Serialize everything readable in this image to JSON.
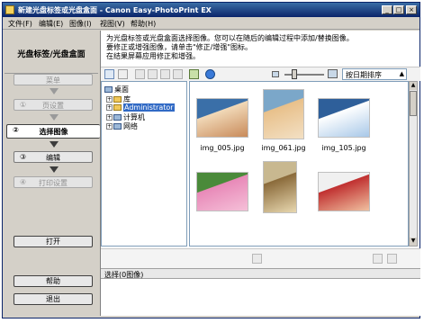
{
  "window": {
    "title": "新建光盘标签或光盘盒面 - Canon Easy-PhotoPrint EX"
  },
  "menu": [
    "文件(F)",
    "编辑(E)",
    "图像(I)",
    "视图(V)",
    "帮助(H)"
  ],
  "left_panel": {
    "heading": "光盘标签/光盘盒面",
    "steps": [
      {
        "num": "",
        "label": "菜单",
        "state": "disabled"
      },
      {
        "num": "①",
        "label": "页设置",
        "state": "disabled"
      },
      {
        "num": "②",
        "label": "选择图像",
        "state": "active"
      },
      {
        "num": "③",
        "label": "编辑",
        "state": "enabled"
      },
      {
        "num": "④",
        "label": "打印设置",
        "state": "disabled"
      }
    ],
    "open_label": "打开",
    "help_label": "帮助",
    "exit_label": "退出"
  },
  "instructions": "为光盘标签或光盘盒面选择图像。您可以在随后的编辑过程中添加/替换图像。\n要修正或增强图像，请单击\"修正/增强\"图标。\n在结果屏幕应用修正和增强。",
  "toolbar": {
    "sort_value": "按日期排序"
  },
  "tree": {
    "root": "桌面",
    "items": [
      "库",
      "Administrator",
      "计算机",
      "网络"
    ],
    "selected": "Administrator"
  },
  "images": [
    {
      "name": "img_005.jpg",
      "colors": [
        "#3a6fa8",
        "#f1d9b8",
        "#c88a5a"
      ]
    },
    {
      "name": "img_061.jpg",
      "colors": [
        "#7ba7c9",
        "#e8c08a",
        "#f3e0c4"
      ]
    },
    {
      "name": "img_105.jpg",
      "colors": [
        "#2e5f9a",
        "#ffffff",
        "#a8c8e8"
      ]
    },
    {
      "name": "",
      "colors": [
        "#4a8a3a",
        "#e889b8",
        "#f5c0d8"
      ]
    },
    {
      "name": "",
      "colors": [
        "#c8b890",
        "#8a6a3a",
        "#e8d8b0"
      ]
    },
    {
      "name": "",
      "colors": [
        "#f0f0f0",
        "#c03030",
        "#f0c0a0"
      ]
    }
  ],
  "selection": {
    "label": "选择(0图像)"
  }
}
